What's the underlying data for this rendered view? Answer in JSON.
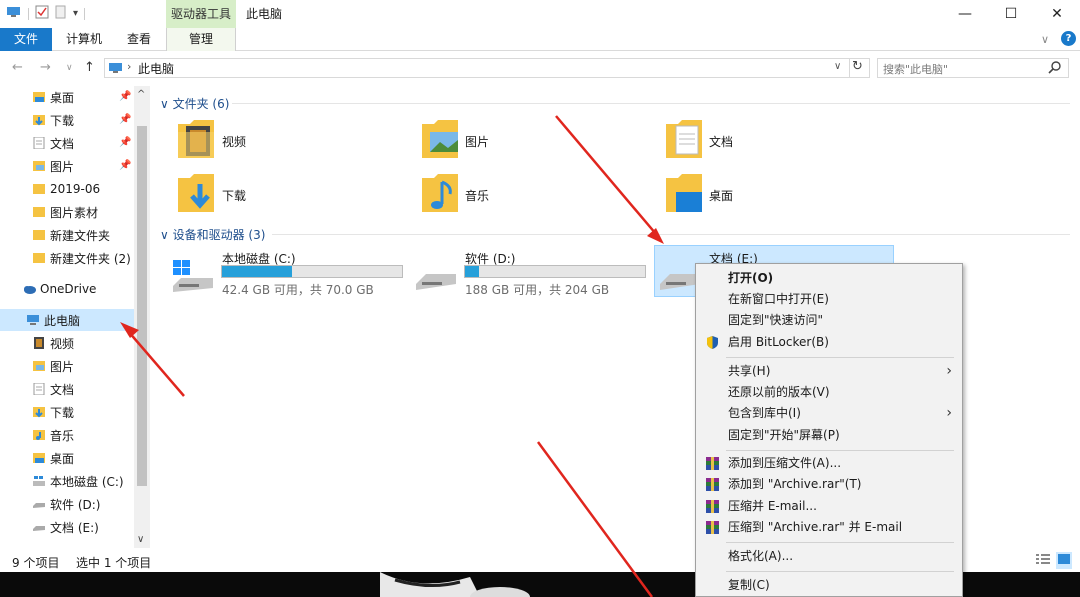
{
  "titlebar": {
    "drive_tools": "驱动器工具",
    "title": "此电脑",
    "minimize": "—",
    "maximize": "☐",
    "close": "✕"
  },
  "tabs": {
    "file": "文件",
    "computer": "计算机",
    "view": "查看",
    "manage": "管理"
  },
  "address": {
    "path": "此电脑",
    "search_placeholder": "搜索\"此电脑\""
  },
  "sidebar": {
    "quick": [
      {
        "label": "桌面",
        "pinned": true
      },
      {
        "label": "下载",
        "pinned": true
      },
      {
        "label": "文档",
        "pinned": true
      },
      {
        "label": "图片",
        "pinned": true
      },
      {
        "label": "2019-06"
      },
      {
        "label": "图片素材"
      },
      {
        "label": "新建文件夹"
      },
      {
        "label": "新建文件夹 (2)"
      }
    ],
    "onedrive": "OneDrive",
    "thispc": "此电脑",
    "pc_items": [
      "视频",
      "图片",
      "文档",
      "下载",
      "音乐",
      "桌面",
      "本地磁盘 (C:)",
      "软件 (D:)",
      "文档 (E:)"
    ]
  },
  "content": {
    "folders_header": "文件夹 (6)",
    "folders": [
      "视频",
      "图片",
      "文档",
      "下载",
      "音乐",
      "桌面"
    ],
    "drives_header": "设备和驱动器 (3)",
    "drives": [
      {
        "name": "本地磁盘 (C:)",
        "capacity": "42.4 GB 可用，共 70.0 GB",
        "used_fraction": 0.39
      },
      {
        "name": "软件 (D:)",
        "capacity": "188 GB 可用，共 204 GB",
        "used_fraction": 0.08
      },
      {
        "name": "文档 (E:)"
      }
    ]
  },
  "status": {
    "count": "9 个项目",
    "selected": "选中 1 个项目"
  },
  "context_menu": {
    "open": "打开(O)",
    "open_new_window": "在新窗口中打开(E)",
    "pin_quick": "固定到\"快速访问\"",
    "bitlocker": "启用 BitLocker(B)",
    "share": "共享(H)",
    "restore": "还原以前的版本(V)",
    "include_library": "包含到库中(I)",
    "pin_start": "固定到\"开始\"屏幕(P)",
    "add_archive": "添加到压缩文件(A)...",
    "add_rar": "添加到 \"Archive.rar\"(T)",
    "compress_email": "压缩并 E-mail...",
    "compress_rar_email": "压缩到 \"Archive.rar\" 并 E-mail",
    "format": "格式化(A)...",
    "copy": "复制(C)"
  },
  "colors": {
    "accent": "#1979ca",
    "selected": "#cce8ff",
    "drive_fill": "#26a0da",
    "folder_yellow": "#f5c342",
    "arrow_red": "#e0261e"
  }
}
